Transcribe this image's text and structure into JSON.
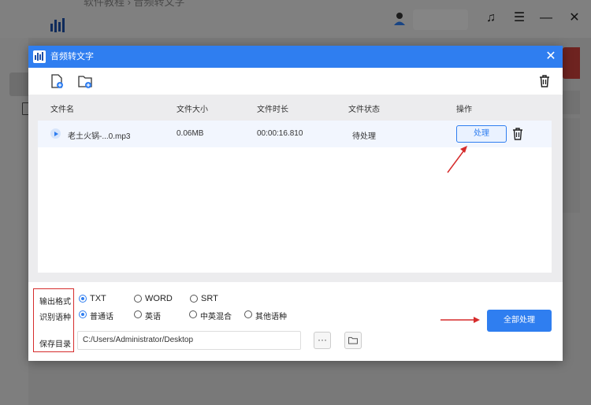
{
  "background": {
    "title_fragment": "软件教程 › 音频转文字"
  },
  "dialog": {
    "title": "音频转文字",
    "close_glyph": "✕"
  },
  "table": {
    "headers": [
      "文件名",
      "文件大小",
      "文件时长",
      "文件状态",
      "操作"
    ],
    "rows": [
      {
        "name": "老土火锅-...0.mp3",
        "size": "0.06MB",
        "duration": "00:00:16.810",
        "status": "待处理",
        "action_label": "处理"
      }
    ]
  },
  "settings": {
    "format_label": "输出格式",
    "language_label": "识别语种",
    "dir_label": "保存目录",
    "formats": [
      {
        "label": "TXT",
        "selected": true
      },
      {
        "label": "WORD",
        "selected": false
      },
      {
        "label": "SRT",
        "selected": false
      }
    ],
    "languages": [
      {
        "label": "普通话",
        "selected": true
      },
      {
        "label": "英语",
        "selected": false
      },
      {
        "label": "中英混合",
        "selected": false
      },
      {
        "label": "其他语种",
        "selected": false
      }
    ],
    "save_path": "C:/Users/Administrator/Desktop",
    "more_label": "···",
    "process_all_label": "全部处理"
  },
  "colors": {
    "accent": "#2f7ef0",
    "annotation": "#d62c2c"
  },
  "icons": [
    "add-file-icon",
    "add-folder-icon",
    "trash-icon",
    "play-icon",
    "folder-icon",
    "close-icon",
    "headset-icon",
    "menu-icon",
    "minimize-icon"
  ]
}
